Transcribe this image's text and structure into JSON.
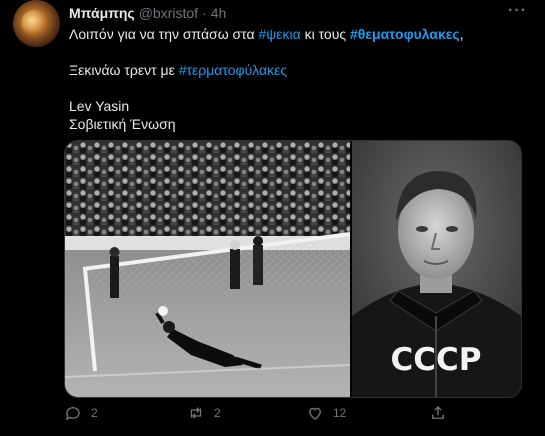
{
  "user": {
    "name": "Μπάμπης",
    "handle": "@bxristof",
    "separator": "·",
    "time": "4h"
  },
  "tweet": {
    "line1_prefix": "Λοιπόν για να την σπάσω στα ",
    "line1_tag1": "#ψεκια",
    "line1_mid": " κι τους ",
    "line1_tag2": "#θεματοφυλακες",
    "line1_suffix": ",",
    "line2_prefix": "Ξεκινάω τρεντ με ",
    "line2_tag": "#τερματοφύλακες",
    "line3": "Lev Yasin",
    "line4": "Σοβιετική Ένωση"
  },
  "media": {
    "jersey_text": "CCCP"
  },
  "actions": {
    "reply_count": "2",
    "retweet_count": "2",
    "like_count": "12",
    "share_count": ""
  },
  "colors": {
    "background": "#000000",
    "text": "#e7e9ea",
    "muted": "#71767b",
    "link": "#1d9bf0"
  }
}
